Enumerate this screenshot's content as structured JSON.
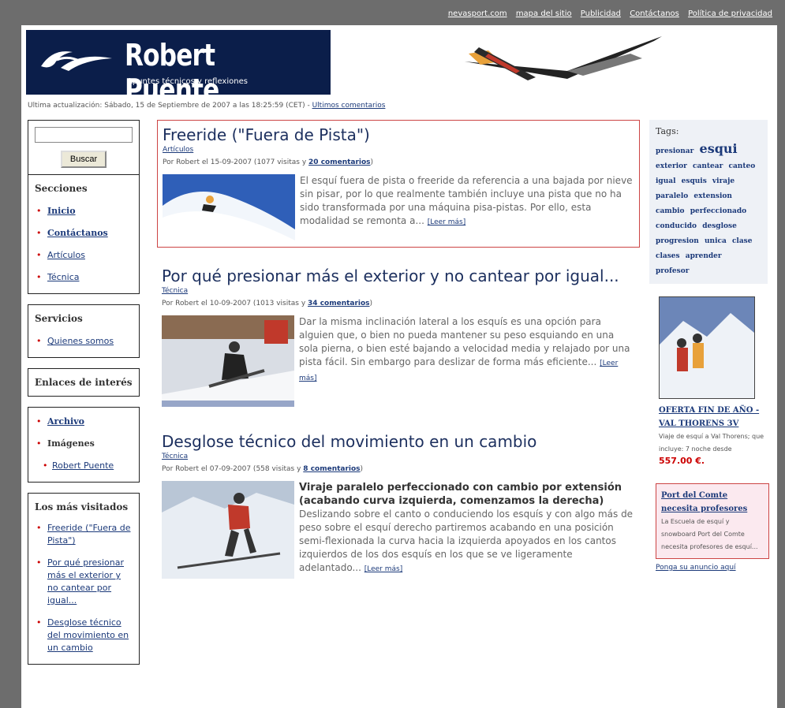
{
  "topnav": {
    "links": [
      "nevasport.com",
      "mapa del sitio",
      "Publicidad",
      "Contáctanos",
      "Política de privacidad"
    ]
  },
  "header": {
    "title": "Robert Puente",
    "subtitle": "Apuntes técnicos y reflexiones"
  },
  "last_update": {
    "text": "Ultima actualización: Sábado, 15 de Septiembre de 2007 a las 18:25:59 (CET) -",
    "link": "Ultimos comentarios"
  },
  "sidebar": {
    "search_button": "Buscar",
    "sections_title": "Secciones",
    "sections": [
      "Inicio",
      "Contáctanos",
      "Artículos",
      "Técnica"
    ],
    "services_title": "Servicios",
    "services": [
      "Quienes somos"
    ],
    "links_title": "Enlaces de interés",
    "archive": "Archivo",
    "images": "Imágenes",
    "images_sub": "Robert Puente",
    "popular_title": "Los más visitados",
    "popular": [
      "Freeride (\"Fuera de Pista\")",
      "Por qué presionar más el exterior y no cantear por igual...",
      "Desglose técnico del movimiento en un cambio"
    ]
  },
  "posts": [
    {
      "title": "Freeride (\"Fuera de Pista\")",
      "category": "Artículos",
      "meta": "Por Robert el 15-09-2007 (1077 visitas y",
      "comments": "20 comentarios",
      "meta_end": ")",
      "text": "El esquí fuera de pista o freeride da referencia a una bajada por nieve sin pisar, por lo que realmente también incluye una pista que no ha sido transformada por una máquina pisa-pistas. Por ello, esta modalidad se remonta a...",
      "more": "[Leer más]"
    },
    {
      "title": "Por qué presionar más el exterior y no cantear por igual...",
      "category": "Técnica",
      "meta": "Por Robert el 10-09-2007 (1013 visitas y",
      "comments": "34 comentarios",
      "meta_end": ")",
      "text": "Dar la misma inclinación lateral a los esquís es una opción para alguien que, o bien no pueda mantener su peso esquiando en una sola pierna, o bien esté bajando a velocidad media y relajado por una pista fácil. Sin embargo para deslizar de forma más eficiente...",
      "more": "[Leer más]"
    },
    {
      "title": "Desglose técnico del movimiento en un cambio",
      "category": "Técnica",
      "meta": "Por Robert el 07-09-2007 (558 visitas y",
      "comments": "8 comentarios",
      "meta_end": ")",
      "head": "Viraje paralelo perfeccionado con cambio por extensión (acabando curva izquierda, comenzamos la derecha)",
      "text": "Deslizando sobre el canto o conduciendo los esquís y con algo más de peso sobre el esquí derecho partiremos acabando en una posición semi-flexionada la curva hacia la izquierda apoyados en los cantos izquierdos de los dos esquís en los que se ve ligeramente adelantado...",
      "more": "[Leer más]"
    }
  ],
  "tags": {
    "title": "Tags:",
    "items": [
      "presionar",
      "esqui",
      "exterior",
      "cantear",
      "canteo",
      "igual",
      "esquis",
      "viraje",
      "paralelo",
      "extension",
      "cambio",
      "perfeccionado",
      "conducido",
      "desglose",
      "progresion",
      "unica",
      "clase",
      "clases",
      "aprender",
      "profesor"
    ]
  },
  "offer": {
    "title": "OFERTA FIN DE AÑO - VAL THORENS 3V",
    "desc": "Viaje de esquí a Val Thorens; que incluye: 7 noche desde",
    "price": "557.00 €."
  },
  "ad": {
    "title": "Port del Comte necesita profesores",
    "desc": "La Escuela de esquí y snowboard Port del Comte necesita profesores de esquí...",
    "place": "Ponga su anuncio aquí"
  },
  "colors": {
    "navy": "#0b1e4a",
    "link": "#1c3a7a",
    "accent": "#c44444",
    "page_bg": "#6d6d6d"
  }
}
